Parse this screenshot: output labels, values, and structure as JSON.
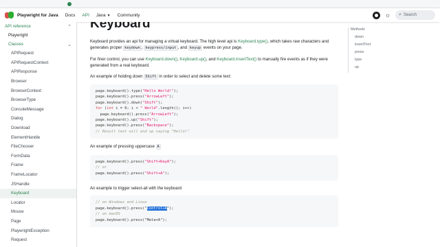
{
  "navbar": {
    "brand": "Playwright for Java",
    "links": [
      "Docs",
      "API"
    ],
    "language": "Java",
    "community": "Community",
    "search_placeholder": "Search"
  },
  "sidebar": {
    "section": "API reference",
    "top_link": "Playwright",
    "group": "Classes",
    "items": [
      "APIRequest",
      "APIRequestContext",
      "APIResponse",
      "Browser",
      "BrowserContext",
      "BrowserType",
      "ConsoleMessage",
      "Dialog",
      "Download",
      "ElementHandle",
      "FileChooser",
      "FormData",
      "Frame",
      "FrameLocator",
      "JSHandle",
      "Keyboard",
      "Locator",
      "Mouse",
      "Page",
      "PlaywrightException",
      "Request"
    ],
    "active": "Keyboard"
  },
  "main": {
    "title": "Keyboard",
    "intro": {
      "t1": "Keyboard provides an api for managing a virtual keyboard. The high level api is ",
      "link1": "Keyboard.type()",
      "t2": ", which takes raw characters and generates proper ",
      "k1": "keydown",
      "t3": ", ",
      "k2": "keypress/input",
      "t4": ", and ",
      "k3": "keyup",
      "t5": " events on your page."
    },
    "finer": {
      "t1": "For finer control, you can use ",
      "l1": "Keyboard.down()",
      "t2": ", ",
      "l2": "Keyboard.up()",
      "t3": ", and ",
      "l3": "Keyboard.insertText()",
      "t4": " to manually fire events as if they were generated from a real keyboard."
    },
    "ex1": {
      "text": "An example of holding down ",
      "kbd": "Shift",
      "text2": " in order to select and delete some text:"
    },
    "code1": [
      "page.keyboard().type(\"Hello World!\");",
      "page.keyboard().press(\"ArrowLeft\");",
      "page.keyboard().down(\"Shift\");",
      "for (int i = 0; i < \" World\".length(); i++)",
      "  page.keyboard().press(\"ArrowLeft\");",
      "page.keyboard().up(\"Shift\");",
      "page.keyboard().press(\"Backspace\");",
      "// Result text will end up saying \"Hello!\""
    ],
    "ex2": {
      "text": "An example of pressing uppercase ",
      "kbd": "A"
    },
    "code2": [
      "page.keyboard().press(\"Shift+KeyA\");",
      "// or",
      "page.keyboard().press(\"Shift+A\");"
    ],
    "ex3": {
      "text": "An example to trigger select-all with the keyboard"
    },
    "code3": {
      "c1": "// on Windows and Linux",
      "l2a": "page.keyboard().press(\"",
      "l2sel": "Control+A",
      "l2b": "\");",
      "c3": "// on macOS",
      "l4": "page.keyboard().press(\"Meta+A\");"
    }
  },
  "toc": {
    "head": "Methods",
    "items": [
      "down",
      "insertText",
      "press",
      "type",
      "up"
    ]
  },
  "colors": {
    "accent": "#2e8555",
    "code_bg": "#f6f7f8",
    "selection": "#1e6fd9"
  }
}
